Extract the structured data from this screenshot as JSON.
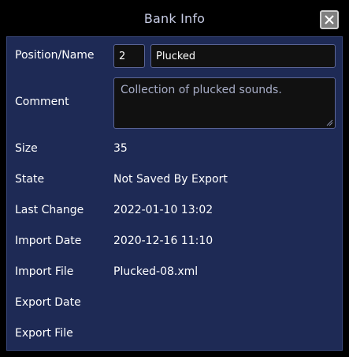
{
  "dialog": {
    "title": "Bank Info"
  },
  "fields": {
    "position_name_label": "Position/Name",
    "position_value": "2",
    "name_value": "Plucked",
    "comment_label": "Comment",
    "comment_value": "Collection of plucked sounds.",
    "size_label": "Size",
    "size_value": "35",
    "state_label": "State",
    "state_value": "Not Saved By Export",
    "last_change_label": "Last Change",
    "last_change_value": "2022-01-10 13:02",
    "import_date_label": "Import Date",
    "import_date_value": "2020-12-16 11:10",
    "import_file_label": "Import File",
    "import_file_value": "Plucked-08.xml",
    "export_date_label": "Export Date",
    "export_date_value": "",
    "export_file_label": "Export File",
    "export_file_value": ""
  },
  "icons": {
    "close": "close-icon",
    "resize": "resize-grip-icon"
  }
}
